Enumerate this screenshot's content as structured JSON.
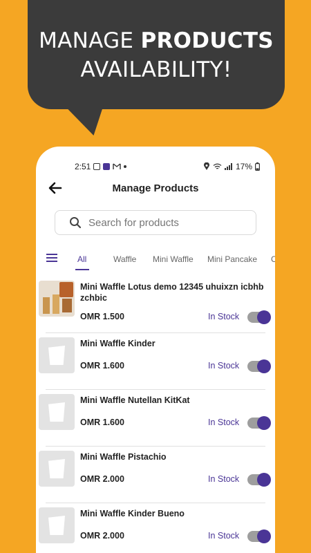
{
  "promo": {
    "line1_plain": "MANAGE ",
    "line1_bold": "PRODUCTS",
    "line2": "AVAILABILITY!"
  },
  "status_bar": {
    "time": "2:51",
    "battery": "17%"
  },
  "header": {
    "title": "Manage Products"
  },
  "search": {
    "placeholder": "Search for products"
  },
  "tabs": [
    "All",
    "Waffle",
    "Mini Waffle",
    "Mini Pancake",
    "C"
  ],
  "active_tab": "All",
  "products": [
    {
      "name": "Mini Waffle Lotus demo 12345 uhuixzn icbhb zchbic",
      "price": "OMR 1.500",
      "stock": "In Stock",
      "enabled": true
    },
    {
      "name": "Mini Waffle Kinder",
      "price": "OMR 1.600",
      "stock": "In Stock",
      "enabled": true
    },
    {
      "name": "Mini Waffle Nutellan KitKat",
      "price": "OMR 1.600",
      "stock": "In Stock",
      "enabled": true
    },
    {
      "name": "Mini Waffle Pistachio",
      "price": "OMR 2.000",
      "stock": "In Stock",
      "enabled": true
    },
    {
      "name": "Mini Waffle Kinder Bueno",
      "price": "OMR 2.000",
      "stock": "In Stock",
      "enabled": true
    }
  ],
  "colors": {
    "background": "#F5A623",
    "bubble": "#3B3B3B",
    "accent": "#4A3596"
  }
}
